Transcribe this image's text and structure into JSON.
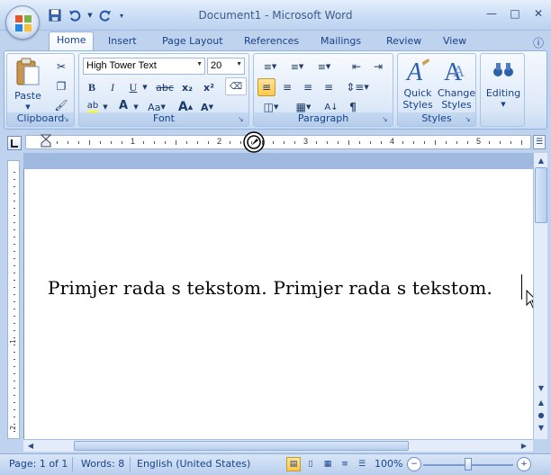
{
  "window": {
    "title": "Document1 - Microsoft Word"
  },
  "tabs": [
    "Home",
    "Insert",
    "Page Layout",
    "References",
    "Mailings",
    "Review",
    "View"
  ],
  "active_tab": "Home",
  "ribbon": {
    "clipboard": {
      "label": "Clipboard",
      "paste_label": "Paste"
    },
    "font": {
      "label": "Font",
      "font_name": "High Tower Text",
      "font_size": "20",
      "bold": "B",
      "italic": "I",
      "underline": "U",
      "strike": "abc",
      "subscript": "x₂",
      "superscript": "x²",
      "change_case": "Aa",
      "grow": "A",
      "shrink": "A"
    },
    "paragraph": {
      "label": "Paragraph",
      "pilcrow": "¶"
    },
    "styles": {
      "label": "Styles",
      "quick_styles": "Quick Styles",
      "change_styles": "Change Styles"
    },
    "editing": {
      "label": "Editing"
    }
  },
  "ruler": {
    "numbers": [
      "1",
      "2",
      "3",
      "4",
      "5"
    ]
  },
  "vertical_ruler": {
    "numbers": [
      "1",
      "2"
    ]
  },
  "document": {
    "text": "Primjer rada s tekstom. Primjer rada s tekstom."
  },
  "status": {
    "page": "Page: 1 of 1",
    "words": "Words: 8",
    "language": "English (United States)",
    "zoom": "100%",
    "zoom_level": 100
  },
  "colors": {
    "accent": "#15428b",
    "selection": "#ffc847",
    "font_color": "#d9241b",
    "highlight": "#ffff00"
  }
}
